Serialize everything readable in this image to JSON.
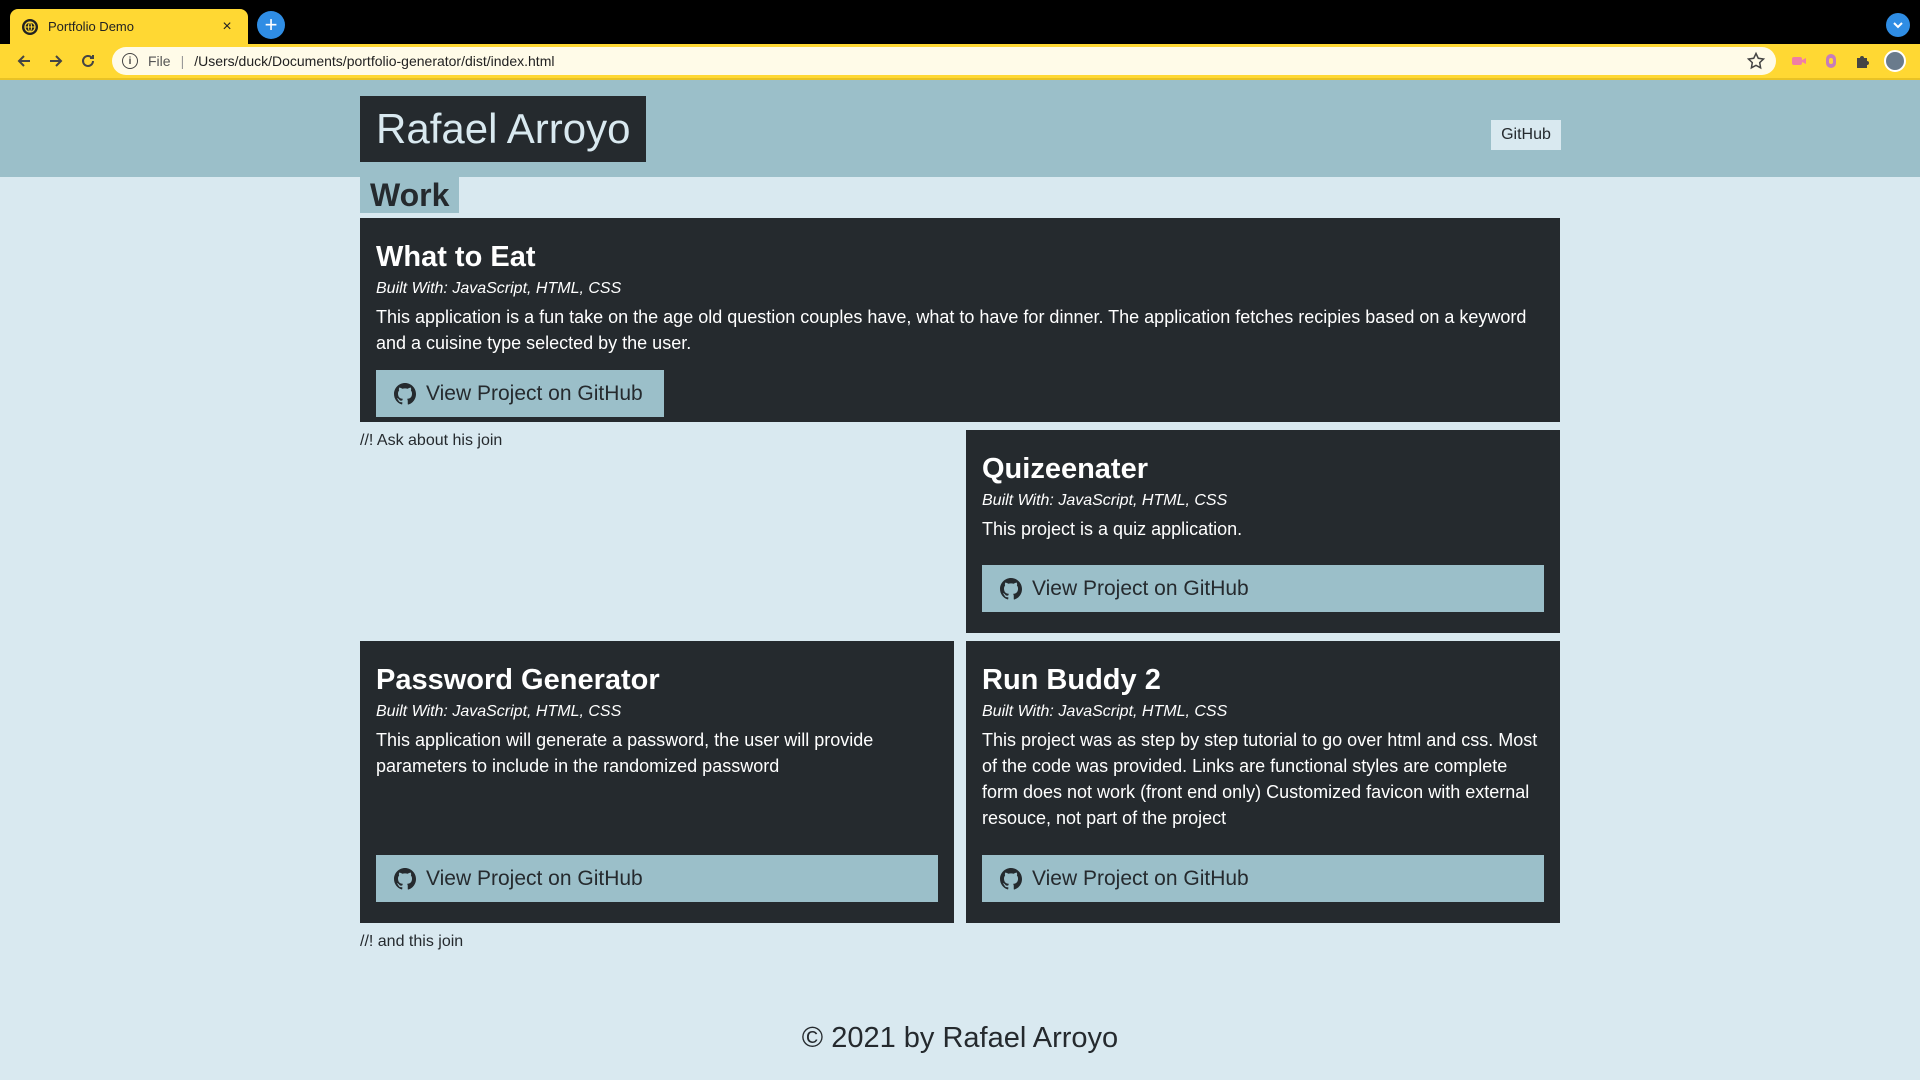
{
  "browser": {
    "tab_title": "Portfolio Demo",
    "tab_close": "×",
    "new_tab": "+",
    "scheme_label": "File",
    "separator": "|",
    "url": "/Users/duck/Documents/portfolio-generator/dist/index.html",
    "accent": "#ffd833"
  },
  "header": {
    "name": "Rafael Arroyo",
    "nav_link": "GitHub"
  },
  "section": {
    "title": "Work"
  },
  "projects": [
    {
      "title": "What to Eat",
      "built_with": "Built With: JavaScript, HTML, CSS",
      "description": "This application is a fun take on the age old question couples have, what to have for dinner. The application fetches recipies based on a keyword and a cuisine type selected by the user.",
      "button": "View Project on GitHub"
    },
    {
      "title": "Quizeenater",
      "built_with": "Built With: JavaScript, HTML, CSS",
      "description": "This project is a quiz application.",
      "button": "View Project on GitHub"
    },
    {
      "title": "Password Generator",
      "built_with": "Built With: JavaScript, HTML, CSS",
      "description": "This application will generate a password, the user will provide parameters to include in the randomized password",
      "button": "View Project on GitHub"
    },
    {
      "title": "Run Buddy 2",
      "built_with": "Built With: JavaScript, HTML, CSS",
      "description": "This project was as step by step tutorial to go over html and css. Most of the code was provided. Links are functional styles are complete form does not work (front end only) Customized favicon with external resouce, not part of the project",
      "button": "View Project on GitHub"
    }
  ],
  "notes": {
    "first": "//! Ask about his join",
    "second": "//! and this join"
  },
  "footer": {
    "text": "© 2021 by Rafael Arroyo"
  },
  "colors": {
    "dark": "#252a2e",
    "light": "#d9e9f0",
    "secondary": "#9bbfc9"
  }
}
